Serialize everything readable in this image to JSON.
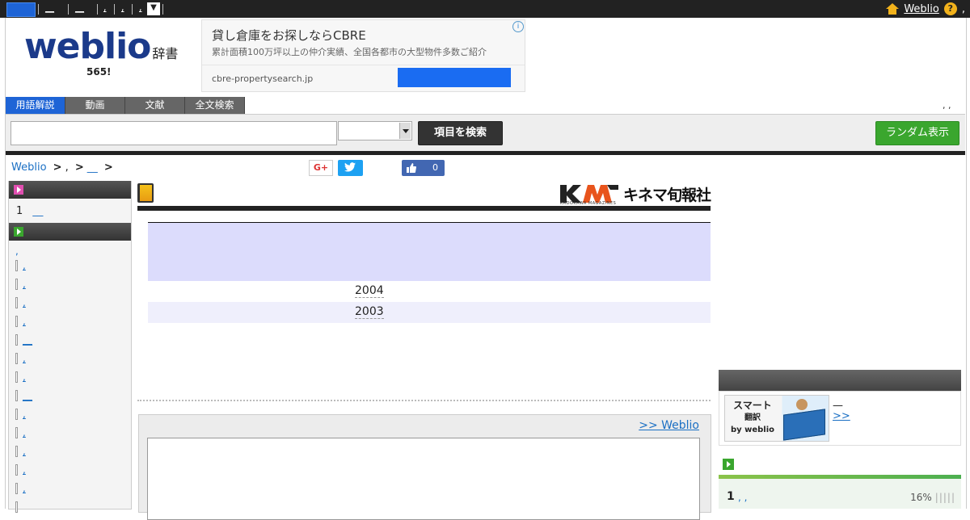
{
  "topbar": {
    "tabs": [
      {
        "label": "",
        "selected": true
      },
      {
        "label": "__"
      },
      {
        "label": "__"
      },
      {
        "label": ","
      },
      {
        "label": ","
      },
      {
        "label": ","
      }
    ],
    "dropdown_glyph": "▼",
    "right_link": "Weblio",
    "help_glyph": "?",
    "trail": ","
  },
  "logo": {
    "main": "weblio",
    "sub": "辞書",
    "count": "565!"
  },
  "ad": {
    "title": "貸し倉庫をお探しならCBRE",
    "description": "累計面積100万坪以上の仲介実績、全国各都市の大型物件多数ご紹介",
    "domain": "cbre-propertysearch.jp",
    "info_glyph": "i"
  },
  "tabs": [
    {
      "label": "用語解説",
      "active": true
    },
    {
      "label": "動画"
    },
    {
      "label": "文献"
    },
    {
      "label": "全文検索"
    }
  ],
  "tabs_right": ", ,",
  "search": {
    "input_value": "",
    "select_value": "",
    "button_label": "項目を検索",
    "random_label": "ランダム表示"
  },
  "breadcrumb": {
    "root": "Weblio",
    "sep": ">",
    "mid": ",",
    "leaf": "__"
  },
  "social": {
    "gplus": "G+",
    "fb_count": "0"
  },
  "left_col": {
    "row1_num": "1",
    "row1_link": "__",
    "first_link": ",",
    "items": [
      ",",
      ",",
      ",",
      ",",
      "__",
      ",",
      ",",
      "__",
      ",",
      ",",
      ",",
      ",",
      ",",
      ""
    ]
  },
  "mid": {
    "publisher": "キネマ旬報社",
    "publisher_sub": "KADOKAWA MAGAZINES",
    "rows": [
      {
        "year": "2004"
      },
      {
        "year": "2003"
      }
    ]
  },
  "box": {
    "link": ">> Weblio"
  },
  "right_col": {
    "smart_title": "スマート",
    "smart_mid": "翻訳",
    "smart_by": "by weblio",
    "dash": "—",
    "more": ">>",
    "rank_num": "1",
    "rank_link": ", ,",
    "rank_pct": "16%",
    "rank_bars": "|||||"
  },
  "colors": {
    "accent": "#1e64d6",
    "logo": "#1b3a8a",
    "random": "#3aa62e",
    "table_head": "#dcdcfc"
  }
}
